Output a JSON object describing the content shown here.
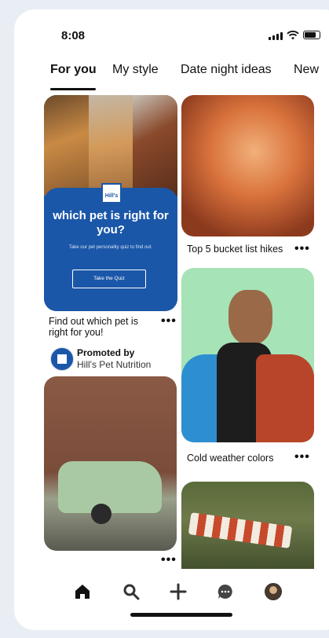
{
  "status_bar": {
    "time": "8:08"
  },
  "tabs": [
    {
      "label": "For you",
      "active": true
    },
    {
      "label": "My style",
      "active": false
    },
    {
      "label": "Date night ideas",
      "active": false
    },
    {
      "label": "New",
      "active": false
    }
  ],
  "ad_pin": {
    "headline": "which pet is right for you?",
    "subtext": "Take our pet personality quiz to find out.",
    "button_label": "Take the Quiz",
    "caption": "Find out which pet is right for you!",
    "promoted_label": "Promoted by",
    "advertiser": "Hill's Pet Nutrition",
    "logo_text": "Hill's",
    "brand_color": "#1b57a8"
  },
  "pins": {
    "canyon": {
      "caption": "Top 5 bucket list hikes"
    },
    "portrait": {
      "caption": "Cold weather colors"
    },
    "camper": {
      "caption": ""
    },
    "hammock": {
      "caption": ""
    }
  },
  "more_label": "•••",
  "bottom_nav": [
    {
      "name": "home",
      "icon": "home-icon",
      "active": true
    },
    {
      "name": "search",
      "icon": "search-icon",
      "active": false
    },
    {
      "name": "create",
      "icon": "plus-icon",
      "active": false
    },
    {
      "name": "messages",
      "icon": "chat-bubble-icon",
      "active": false
    },
    {
      "name": "profile",
      "icon": "avatar-icon",
      "active": false
    }
  ]
}
